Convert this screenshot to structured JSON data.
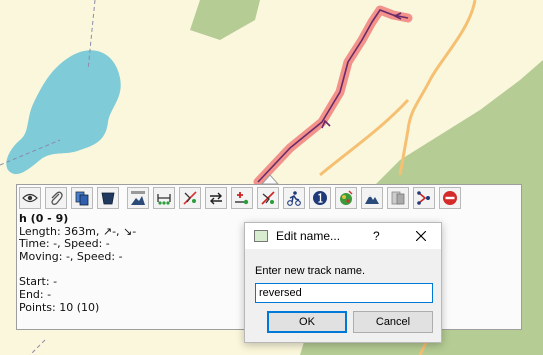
{
  "colors": {
    "map_background": "#fbf7dc",
    "forest": "#b5cc94",
    "water": "#7fcbd8",
    "road": "#f6c073",
    "track_highlight": "#f2928a",
    "track_line": "#6a2a6a",
    "dialog_accent": "#0078d7"
  },
  "toolbar": {
    "buttons": [
      {
        "name": "eye-icon"
      },
      {
        "name": "paperclip-icon"
      },
      {
        "name": "copy-icon"
      },
      {
        "name": "delete-bin-icon"
      },
      {
        "name": "elevation-profile-icon"
      },
      {
        "name": "split-track-icon"
      },
      {
        "name": "filter-track-icon"
      },
      {
        "name": "reverse-track-icon"
      },
      {
        "name": "add-point-icon"
      },
      {
        "name": "remove-point-icon"
      },
      {
        "name": "activity-icon"
      },
      {
        "name": "number-one-icon"
      },
      {
        "name": "color-icon"
      },
      {
        "name": "mountain-icon"
      },
      {
        "name": "export-icon"
      },
      {
        "name": "connect-track-icon"
      },
      {
        "name": "stop-icon"
      }
    ]
  },
  "track_info": {
    "title": "h (0 - 9)",
    "length": "Length: 363m, ↗-, ↘-",
    "time": "Time: -, Speed: -",
    "moving": "Moving: -, Speed: -",
    "start": "Start: -",
    "end": "End: -",
    "points": "Points: 10 (10)"
  },
  "dialog": {
    "title": "Edit name...",
    "help": "?",
    "prompt": "Enter new track name.",
    "input_value": "reversed",
    "ok_label": "OK",
    "cancel_label": "Cancel"
  }
}
